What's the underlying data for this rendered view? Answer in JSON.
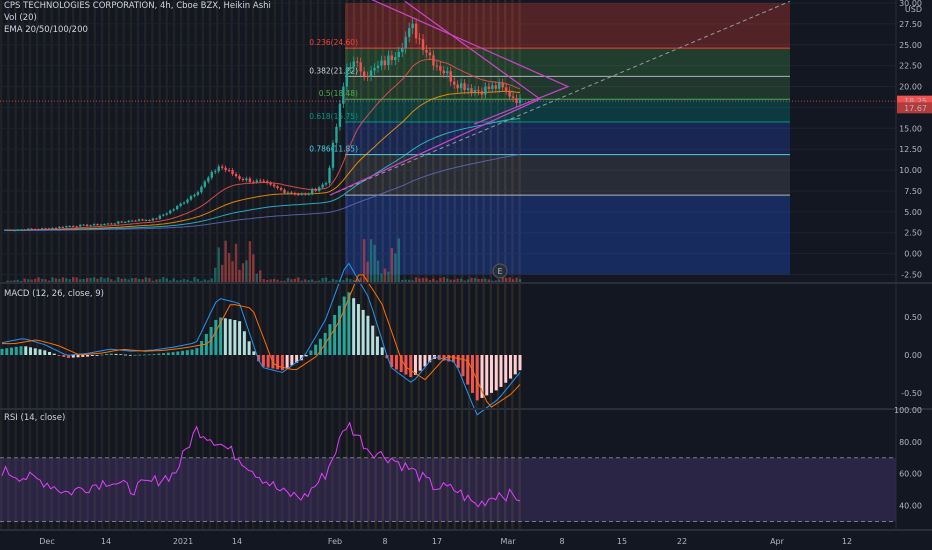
{
  "header": {
    "symbol_line": "CPS TECHNOLOGIES CORPORATION, 4h, Cboe BZX, Heikin Ashi",
    "vol_label": "Vol (20)",
    "ema_label": "EMA 20/50/100/200",
    "macd_label": "MACD (12, 26, close, 9)",
    "rsi_label": "RSI (14, close)"
  },
  "colors": {
    "background": "#131722",
    "up": "#26a69a",
    "down": "#ef5350",
    "ema20": "#ef5350",
    "ema50": "#ff9800",
    "ema100": "#26c6da",
    "ema200": "#5c6bc0",
    "macd_line": "#2196f3",
    "signal_line": "#ff6d00",
    "rsi_line": "#e040fb",
    "rsi_band": "#7e57c2",
    "triangle": "#cc44cc",
    "fib_0236": "#f44336",
    "fib_0382": "#81c784",
    "fib_05": "#4caf50",
    "fib_0618": "#009688",
    "fib_0786": "#4dd0e1"
  },
  "x_axis": {
    "labels": [
      "Dec",
      "14",
      "2021",
      "14",
      "Feb",
      "8",
      "17",
      "Mar",
      "8",
      "15",
      "22",
      "Apr",
      "12"
    ]
  },
  "price_axis": {
    "unit": "USD",
    "ticks": [
      "30.00",
      "27.50",
      "25.00",
      "22.50",
      "20.00",
      "17.50",
      "15.00",
      "12.50",
      "10.00",
      "7.50",
      "5.00",
      "2.50",
      "0.00",
      "-2.50"
    ],
    "last_price": "18.25",
    "second_price": "17.67"
  },
  "macd_axis": {
    "ticks": [
      "0.50",
      "0.00",
      "-0.50"
    ]
  },
  "rsi_axis": {
    "ticks": [
      "100.00",
      "80.00",
      "60.00",
      "40.00"
    ],
    "upper_band": 70,
    "lower_band": 30
  },
  "fib_levels": [
    {
      "label": "0.236(24.60)",
      "price": 24.6
    },
    {
      "label": "0.382(21.22)",
      "price": 21.22
    },
    {
      "label": "0.5(18.48)",
      "price": 18.48
    },
    {
      "label": "0.618(15.75)",
      "price": 15.75
    },
    {
      "label": "0.786(11.85)",
      "price": 11.85
    }
  ],
  "event_marker": "E",
  "chart_data": {
    "type": "line",
    "title": "CPS TECHNOLOGIES CORPORATION, 4h, Cboe BZX, Heikin Ashi",
    "panes": [
      {
        "name": "price",
        "ylim": [
          -2.5,
          30
        ],
        "series": [
          {
            "name": "Heikin Ashi close",
            "dates": [
              "Dec",
              "14",
              "2021",
              "14",
              "Feb",
              "8",
              "17",
              "Mar"
            ],
            "values": [
              2.8,
              2.9,
              3.0,
              3.3,
              3.4,
              3.6,
              4.0,
              4.1,
              5.5,
              7.5,
              10.5,
              9.0,
              8.5,
              7.5,
              7.0,
              8.5,
              23.0,
              21.5,
              23.5,
              27.0,
              23.0,
              20.5,
              19.5,
              20.0,
              18.2
            ]
          }
        ]
      },
      {
        "name": "MACD (12, 26, close, 9)",
        "ylim": [
          -0.6,
          0.85
        ],
        "series": [
          {
            "name": "histogram",
            "values": [
              0.08,
              0.12,
              0.06,
              -0.04,
              -0.02,
              0.02,
              0.0,
              0.01,
              0.04,
              0.08,
              0.5,
              0.45,
              -0.15,
              -0.2,
              -0.05,
              0.3,
              0.85,
              0.5,
              -0.15,
              -0.3,
              -0.05,
              -0.1,
              -0.6,
              -0.45,
              -0.2
            ]
          }
        ]
      },
      {
        "name": "RSI (14, close)",
        "ylim": [
          30,
          100
        ],
        "series": [
          {
            "name": "RSI",
            "values": [
              62,
              58,
              55,
              48,
              52,
              56,
              50,
              55,
              60,
              88,
              80,
              70,
              58,
              48,
              45,
              60,
              92,
              75,
              70,
              62,
              52,
              50,
              40,
              48,
              45
            ]
          }
        ]
      }
    ]
  }
}
